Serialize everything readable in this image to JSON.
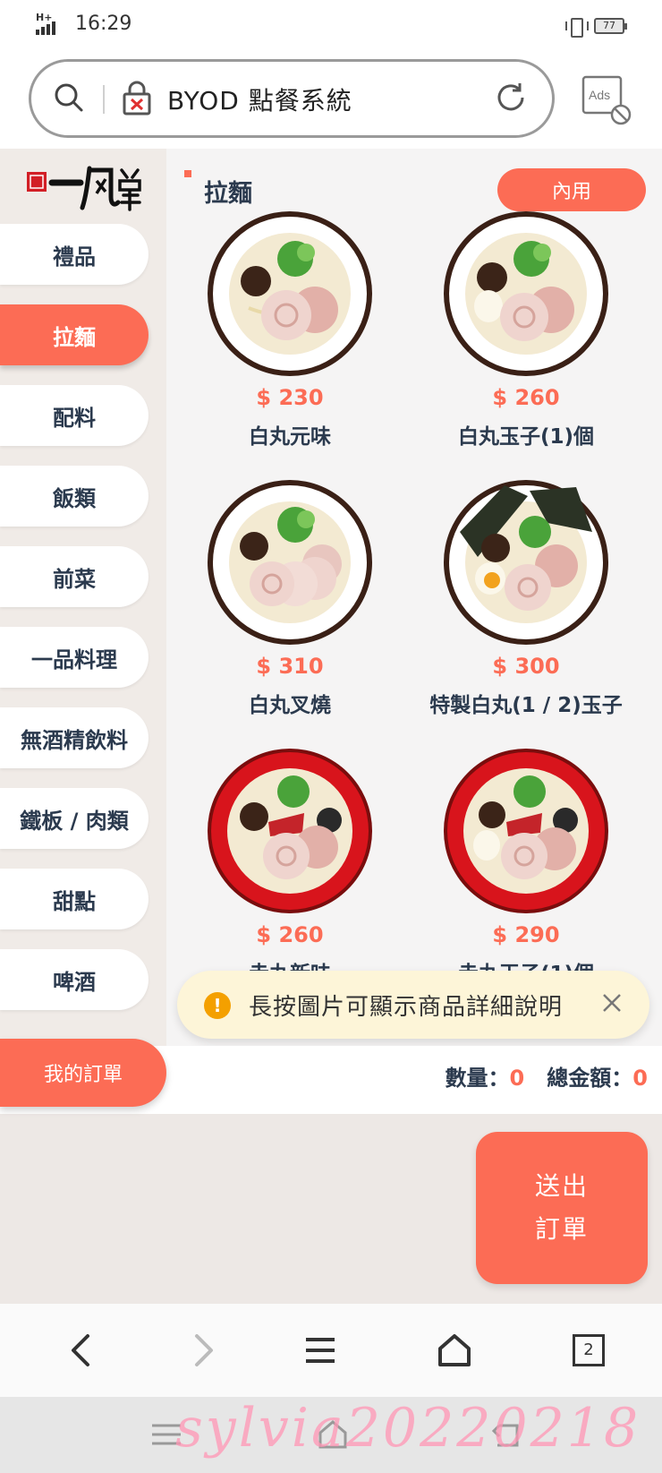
{
  "status_bar": {
    "time": "16:29",
    "network": "H+",
    "battery": "77"
  },
  "browser": {
    "url_text": "BYOD 點餐系統",
    "ads_label": "Ads"
  },
  "sidebar": {
    "items": [
      {
        "label": "禮品"
      },
      {
        "label": "拉麵",
        "active": true
      },
      {
        "label": "配料"
      },
      {
        "label": "飯類"
      },
      {
        "label": "前菜"
      },
      {
        "label": "一品料理"
      },
      {
        "label": "無酒精飲料"
      },
      {
        "label": "鐵板 / 肉類"
      },
      {
        "label": "甜點"
      },
      {
        "label": "啤酒"
      }
    ],
    "my_order": "我的訂單"
  },
  "main": {
    "section_title": "拉麵",
    "dine_in": "內用",
    "products": [
      {
        "price": "$ 230",
        "name": "白丸元味"
      },
      {
        "price": "$ 260",
        "name": "白丸玉子(1)個"
      },
      {
        "price": "$ 310",
        "name": "白丸叉燒"
      },
      {
        "price": "$ 300",
        "name": "特製白丸(1 / 2)玉子"
      },
      {
        "price": "$ 260",
        "name": "赤丸新味"
      },
      {
        "price": "$ 290",
        "name": "赤丸玉子(1)個"
      }
    ]
  },
  "toast": {
    "text": "長按圖片可顯示商品詳細說明"
  },
  "order_summary": {
    "qty_label": "數量：",
    "qty_value": "0",
    "total_label": "總金額：",
    "total_value": "0"
  },
  "submit": {
    "line1": "送出",
    "line2": "訂單"
  },
  "bottom_nav": {
    "tab_count": "2"
  },
  "watermark": "sylvia20220218",
  "colors": {
    "accent": "#fc6c55",
    "text": "#2b3a4e"
  }
}
